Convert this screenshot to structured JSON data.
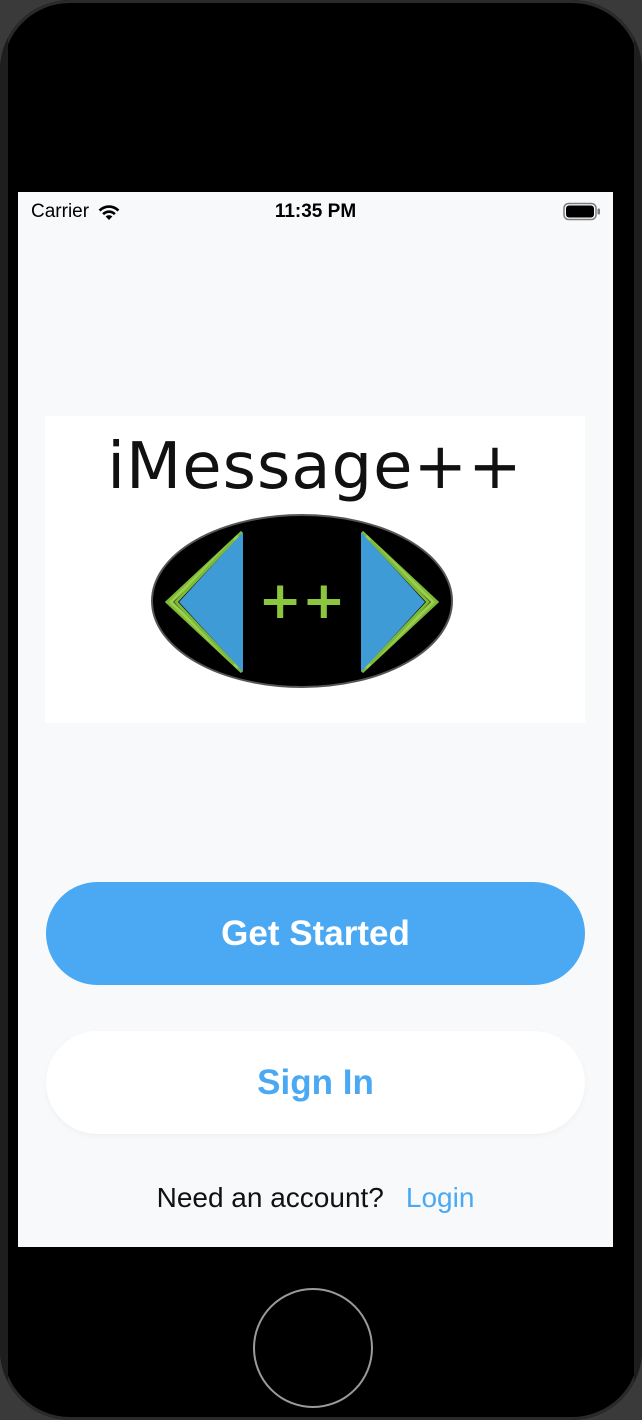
{
  "status_bar": {
    "carrier": "Carrier",
    "time": "11:35 PM",
    "wifi_icon": "wifi-icon",
    "battery_icon": "battery-full-icon"
  },
  "logo": {
    "text": "iMessage++",
    "emblem_text": "++",
    "colors": {
      "emblem_bg": "#000000",
      "arrow_blue": "#3e9bd6",
      "arrow_green": "#8cc63f"
    }
  },
  "buttons": {
    "get_started": "Get Started",
    "sign_in": "Sign In"
  },
  "account": {
    "prompt": "Need an account?",
    "login": "Login"
  },
  "colors": {
    "accent": "#4aa9f2",
    "background": "#f8f9fb"
  }
}
